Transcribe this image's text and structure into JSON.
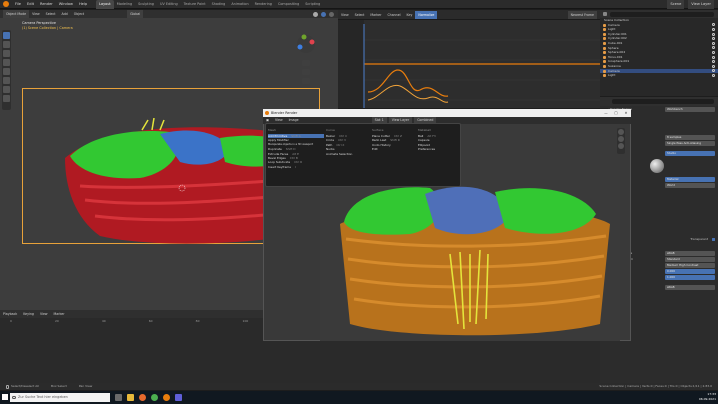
{
  "menubar": {
    "menus": [
      "File",
      "Edit",
      "Render",
      "Window",
      "Help"
    ],
    "workspaces": [
      "Layout",
      "Modeling",
      "Sculpting",
      "UV Editing",
      "Texture Paint",
      "Shading",
      "Animation",
      "Rendering",
      "Compositing",
      "Scripting"
    ],
    "active_workspace": "Layout",
    "scene": "Scene",
    "view_layer": "View Layer"
  },
  "viewport": {
    "mode": "Object Mode",
    "menus": [
      "View",
      "Select",
      "Add",
      "Object"
    ],
    "orientation": "Global",
    "overlay_title": "Camera Perspective",
    "overlay_subtitle": "(1) Scene Collection | Camera"
  },
  "graph_editor": {
    "menus": [
      "View",
      "Select",
      "Marker",
      "Channel",
      "Key"
    ],
    "mode": "Normalize",
    "pivot": "Nearest Frame"
  },
  "outliner": {
    "title": "Scene Collection",
    "items": [
      {
        "label": "Camera",
        "selected": false
      },
      {
        "label": "Light",
        "selected": false
      },
      {
        "label": "Cylinder.001",
        "selected": false
      },
      {
        "label": "Cylinder.002",
        "selected": false
      },
      {
        "label": "Cube.001",
        "selected": false
      },
      {
        "label": "Sphere",
        "selected": false
      },
      {
        "label": "Sphere.002",
        "selected": false
      },
      {
        "label": "Torus.001",
        "selected": false
      },
      {
        "label": "Icosphere.001",
        "selected": false
      },
      {
        "label": "Suzanne",
        "selected": false
      },
      {
        "label": "Camera",
        "selected": true
      },
      {
        "label": "Light",
        "selected": false
      }
    ]
  },
  "properties": {
    "render_engine_label": "Render Engine",
    "render_engine": "Workbench",
    "rows": [
      {
        "label": "Sampling",
        "value": "8 samples"
      },
      {
        "label": "Viewport",
        "value": "Single Pass Anti-Aliasing"
      },
      {
        "label": "Lighting",
        "value": "Studio"
      },
      {
        "label": "Color",
        "value": "Material"
      },
      {
        "label": "Background",
        "value": "World"
      },
      {
        "label": "Options",
        "value": ""
      },
      {
        "label": "Transparent",
        "value": ""
      },
      {
        "label": "Display Device",
        "value": "sRGB"
      },
      {
        "label": "View Transform",
        "value": "Standard"
      },
      {
        "label": "Look",
        "value": "Medium High Contrast"
      },
      {
        "label": "Exposure",
        "value": "0.000"
      },
      {
        "label": "Gamma",
        "value": "1.000"
      },
      {
        "label": "Sequencer",
        "value": "sRGB"
      }
    ],
    "panel_use_curves": "Use Curves"
  },
  "timeline": {
    "menus": [
      "Playback",
      "Keying",
      "View",
      "Marker"
    ],
    "frames": [
      "0",
      "20",
      "40",
      "60",
      "80",
      "100",
      "120",
      "140",
      "160",
      "180",
      "200",
      "220",
      "240"
    ]
  },
  "status": {
    "left": "Select/Deselect All",
    "middle": "Box Select",
    "middle2": "Pan View",
    "right": "Scene Collection | Camera | Verts:0 | Faces:0 | Tris:0 | Objects:1/11 | 2.83.0"
  },
  "render_window": {
    "title": "Blender Render",
    "menus": [
      "View",
      "Image"
    ],
    "slot": "Slot 1",
    "layer": "View Layer",
    "pass": "Combined"
  },
  "add_menu": {
    "columns": [
      {
        "header": "Mesh",
        "items": [
          {
            "label": "Add Primitive",
            "shortcut": "Shift A",
            "highlighted": true
          },
          {
            "label": "Apply Modifier",
            "shortcut": ""
          },
          {
            "label": "Manipulate objects in a 3D viewport",
            "shortcut": ""
          },
          {
            "label": "Duplicate",
            "shortcut": "Shift D"
          },
          {
            "label": "Extrude Faces",
            "shortcut": "Alt E"
          },
          {
            "label": "Bevel Edges",
            "shortcut": "Ctrl B"
          },
          {
            "label": "Loop Subdivide",
            "shortcut": "Ctrl R"
          },
          {
            "label": "Insert Keyframe",
            "shortcut": "I"
          }
        ]
      },
      {
        "header": "Curve",
        "items": [
          {
            "label": "Bezier",
            "shortcut": "Ctrl C"
          },
          {
            "label": "Circle",
            "shortcut": "Ctrl V"
          },
          {
            "label": "Path",
            "shortcut": "Ctrl X"
          },
          {
            "label": "Nurbs",
            "shortcut": ""
          },
          {
            "label": "Animate Selection",
            "shortcut": ""
          }
        ]
      },
      {
        "header": "Surface",
        "items": [
          {
            "label": "Plane Cutter",
            "shortcut": "Ctrl Z"
          },
          {
            "label": "Redo Last",
            "shortcut": "Shift R"
          },
          {
            "label": "Undo History",
            "shortcut": ""
          },
          {
            "label": "Edit",
            "shortcut": ""
          }
        ]
      },
      {
        "header": "Metaball",
        "items": [
          {
            "label": "Ball",
            "shortcut": "Alt F3"
          },
          {
            "label": "Capsule",
            "shortcut": ""
          },
          {
            "label": "Ellipsoid",
            "shortcut": ""
          },
          {
            "label": "Preferences",
            "shortcut": ""
          }
        ]
      }
    ]
  },
  "taskbar": {
    "search_placeholder": "Zur Suche Text hier eingeben",
    "time": "17:33",
    "date": "06.09.2021"
  }
}
